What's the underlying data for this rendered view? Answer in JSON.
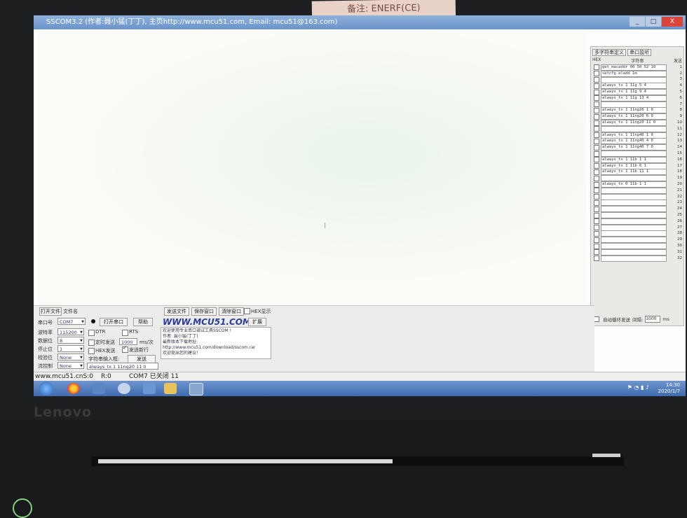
{
  "window": {
    "title": "SSCOM3.2 (作者:聂小猛(丁丁), 主页http://www.mcu51.com, Email: mcu51@163.com)",
    "win_buttons": [
      "_",
      "□",
      "X"
    ]
  },
  "right_panel": {
    "tab_multi": "多字符串定义",
    "tab_port": "串口监听",
    "col_hex": "HEX",
    "col_str": "字符串",
    "col_send": "发送",
    "rows": [
      {
        "text": "get_macaddr 00 50 52 10",
        "num": "1"
      },
      {
        "text": "setcfg eladd 1m",
        "num": "2"
      },
      {
        "text": "",
        "num": "3"
      },
      {
        "text": "always_tx 1 11g 5 4",
        "num": "4"
      },
      {
        "text": "always_tx 1 11g 9 4",
        "num": "5"
      },
      {
        "text": "always_tx 1 11g 13 4",
        "num": "6"
      },
      {
        "text": "",
        "num": "7"
      },
      {
        "text": "always_tx 1 11ng20 1 0",
        "num": "8"
      },
      {
        "text": "always_tx 1 11ng20 6 0",
        "num": "9"
      },
      {
        "text": "always_tx 1 11ng20 11 0",
        "num": "10"
      },
      {
        "text": "",
        "num": "11"
      },
      {
        "text": "always_tx 1 11ng40 1 0",
        "num": "12"
      },
      {
        "text": "always_tx 1 11ng40 4 0",
        "num": "13"
      },
      {
        "text": "always_tx 1 11ng40 7 0",
        "num": "14"
      },
      {
        "text": "",
        "num": "15"
      },
      {
        "text": "always_tx 1 11b 1 1",
        "num": "16"
      },
      {
        "text": "always_tx 1 11b 6 1",
        "num": "17"
      },
      {
        "text": "always_tx 1 11b 11 1",
        "num": "18"
      },
      {
        "text": "",
        "num": "19"
      },
      {
        "text": "always_tx 0 11b 1 1",
        "num": "20"
      },
      {
        "text": "",
        "num": "21"
      },
      {
        "text": "",
        "num": "22"
      },
      {
        "text": "",
        "num": "23"
      },
      {
        "text": "",
        "num": "24"
      },
      {
        "text": "",
        "num": "25"
      },
      {
        "text": "",
        "num": "26"
      },
      {
        "text": "",
        "num": "27"
      },
      {
        "text": "",
        "num": "28"
      },
      {
        "text": "",
        "num": "29"
      },
      {
        "text": "",
        "num": "30"
      },
      {
        "text": "",
        "num": "31"
      },
      {
        "text": "",
        "num": "32"
      }
    ],
    "auto_loop": "自动循环发送",
    "interval_label": "间隔:",
    "interval_value": "1000",
    "interval_unit": "ms"
  },
  "controls": {
    "open_file": "打开文件",
    "file_name_label": "文件名",
    "send_file": "发送文件",
    "save_window": "保存窗口",
    "clear_window": "清除窗口",
    "hex_display": "HEX显示",
    "port_label": "串口号",
    "port_value": "COM7",
    "open_port": "打开串口",
    "help": "帮助",
    "website": "WWW.MCU51.COM",
    "expand": "扩展",
    "baud_label": "波特率",
    "baud_value": "115200",
    "data_bits_label": "数据位",
    "data_bits_value": "8",
    "stop_bits_label": "停止位",
    "stop_bits_value": "1",
    "parity_label": "校验位",
    "parity_value": "None",
    "flow_label": "流控制",
    "flow_value": "None",
    "dtr": "DTR",
    "rts": "RTS",
    "timed_send": "定时发送",
    "timed_value": "1000",
    "timed_unit": "ms/次",
    "hex_send": "HEX发送",
    "send_newline": "发送新行",
    "string_input_label": "字符串输入框:",
    "send": "发送",
    "send_text": "always_tx 1 11ng20 11 0",
    "info_lines": [
      "欢迎使用专业串口调试工具SSCOM !",
      "作者: 聂小猛(丁丁)",
      "最新版本下载地址:",
      "http://www.mcu51.com/download/sscom.rar",
      "欢迎提出您的建议!"
    ]
  },
  "status_bar": {
    "site": "www.mcu51.cnS:0",
    "r": "R:0",
    "port_status": "COM7 已关闭 11"
  },
  "taskbar": {
    "time": "14:30",
    "date": "2020/1/7"
  },
  "laptop": {
    "brand": "Lenovo",
    "note": "备注: ENERF(CE)"
  }
}
